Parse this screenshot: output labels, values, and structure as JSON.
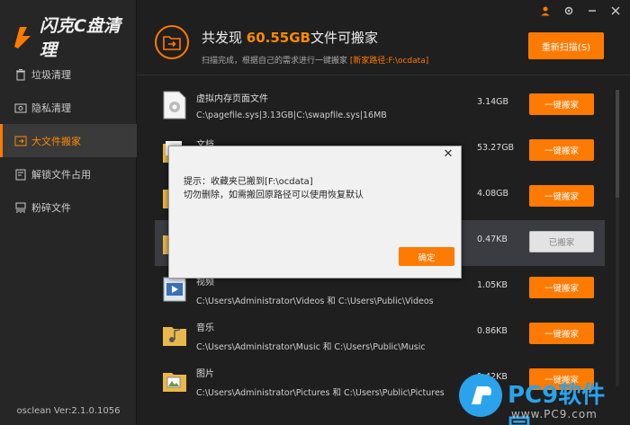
{
  "app": {
    "logo_text": "闪克C盘清理",
    "version": "osclean Ver:2.1.0.1056"
  },
  "sidebar": {
    "items": [
      {
        "label": "垃圾清理",
        "icon": "trash-icon",
        "active": false
      },
      {
        "label": "隐私清理",
        "icon": "privacy-icon",
        "active": false
      },
      {
        "label": "大文件搬家",
        "icon": "folder-move-icon",
        "active": true
      },
      {
        "label": "解锁文件占用",
        "icon": "unlock-icon",
        "active": false
      },
      {
        "label": "粉碎文件",
        "icon": "shred-icon",
        "active": false
      }
    ]
  },
  "header": {
    "found_prefix": "共发现",
    "found_size": "60.55GB",
    "found_suffix": "文件可搬家",
    "sub_text": "扫描完成，根据自己的需求进行一键搬家",
    "new_path": "[新家路径:F:\\ocdata]",
    "rescan_label": "重新扫描(S)"
  },
  "rows": [
    {
      "name": "虚拟内存页面文件",
      "path": "C:\\pagefile.sys|3.13GB|C:\\swapfile.sys|16MB",
      "size": "3.14GB",
      "btn": "一键搬家",
      "done": false
    },
    {
      "name": "文档",
      "path": "",
      "size": "53.27GB",
      "btn": "一键搬家",
      "done": false
    },
    {
      "name": "",
      "path": "",
      "size": "4.08GB",
      "btn": "一键搬家",
      "done": false
    },
    {
      "name": "",
      "path": "",
      "size": "0.47KB",
      "btn": "已搬家",
      "done": true
    },
    {
      "name": "视频",
      "path": "C:\\Users\\Administrator\\Videos 和 C:\\Users\\Public\\Videos",
      "size": "1.05KB",
      "btn": "一键搬家",
      "done": false
    },
    {
      "name": "音乐",
      "path": "C:\\Users\\Administrator\\Music 和 C:\\Users\\Public\\Music",
      "size": "0.86KB",
      "btn": "一键搬家",
      "done": false
    },
    {
      "name": "图片",
      "path": "C:\\Users\\Administrator\\Pictures 和 C:\\Users\\Public\\Pictures",
      "size": "1.42KB",
      "btn": "一键搬家",
      "done": false
    }
  ],
  "dialog": {
    "line1": "提示：收藏夹已搬到[F:\\ocdata]",
    "line2": "切勿删除，如需搬回原路径可以使用恢复默认",
    "ok_label": "确定",
    "close_glyph": "✕"
  },
  "watermark": {
    "text": "PC9软件园",
    "url": "www.PC9.com"
  },
  "colors": {
    "accent": "#ff7a00",
    "bg": "#1f1f1f",
    "sidebar": "#262626"
  }
}
